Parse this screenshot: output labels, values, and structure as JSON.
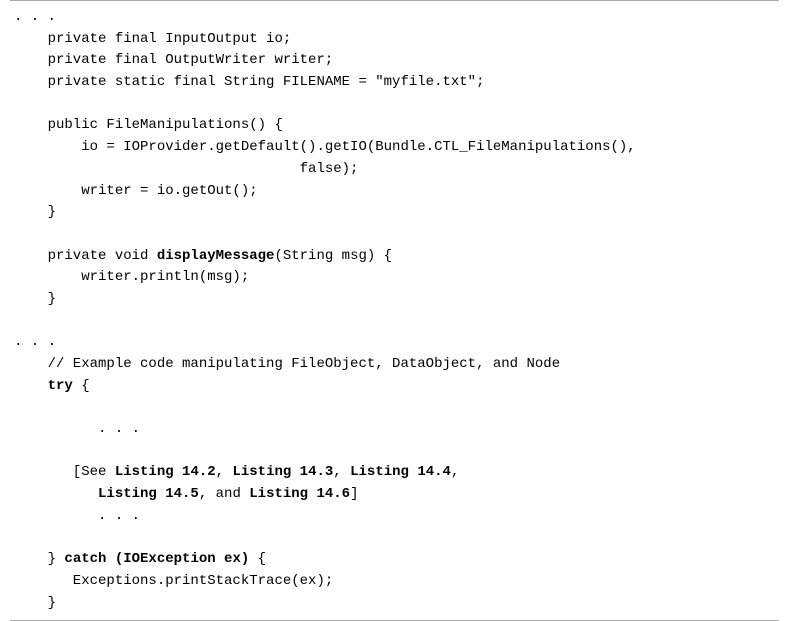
{
  "code": {
    "l01": ". . .",
    "l02": "    private final InputOutput io;",
    "l03": "    private final OutputWriter writer;",
    "l04": "    private static final String FILENAME = \"myfile.txt\";",
    "l05": "",
    "l06": "    public FileManipulations() {",
    "l07": "        io = IOProvider.getDefault().getIO(Bundle.CTL_FileManipulations(),",
    "l08": "                                  false);",
    "l09": "        writer = io.getOut();",
    "l10": "    }",
    "l11": "",
    "l12_a": "    private void ",
    "l12_b": "displayMessage",
    "l12_c": "(String msg) {",
    "l13": "        writer.println(msg);",
    "l14": "    }",
    "l15": "",
    "l16": ". . .",
    "l17": "    // Example code manipulating FileObject, DataObject, and Node",
    "l18_a": "    ",
    "l18_b": "try",
    "l18_c": " {",
    "l19": "",
    "l20": "          . . .",
    "l21": "",
    "l22_a": "       [See ",
    "l22_b": "Listing 14.2",
    "l22_c": ", ",
    "l22_d": "Listing 14.3",
    "l22_e": ", ",
    "l22_f": "Listing 14.4",
    "l22_g": ",",
    "l23_a": "          ",
    "l23_b": "Listing 14.5",
    "l23_c": ", and ",
    "l23_d": "Listing 14.6",
    "l23_e": "]",
    "l24": "          . . .",
    "l25": "",
    "l26_a": "    } ",
    "l26_b": "catch (IOException ex)",
    "l26_c": " {",
    "l27": "       Exceptions.printStackTrace(ex);",
    "l28": "    }"
  }
}
